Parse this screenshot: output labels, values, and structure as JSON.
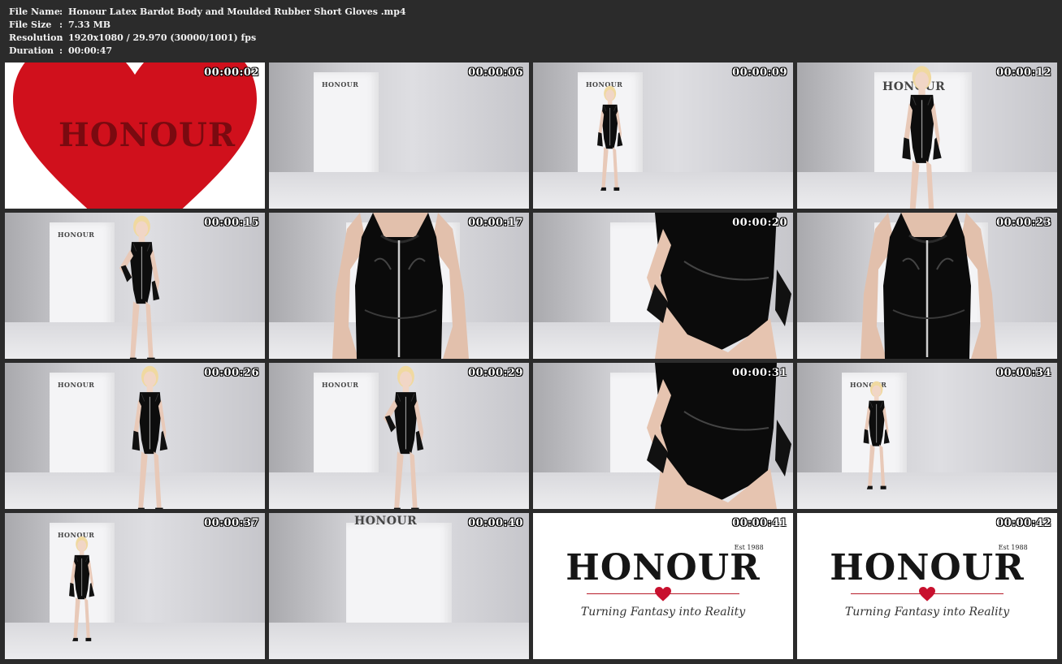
{
  "info": {
    "file_name_label": "File Name",
    "file_name": "Honour Latex Bardot Body and Moulded Rubber Short Gloves .mp4",
    "file_size_label": "File Size",
    "file_size": "7.33 MB",
    "resolution_label": "Resolution",
    "resolution": "1920x1080 / 29.970 (30000/1001) fps",
    "duration_label": "Duration",
    "duration": "00:00:47",
    "separator": ":"
  },
  "thumbs": [
    {
      "timestamp": "00:00:02",
      "kind": "heart",
      "sign": "HONOUR"
    },
    {
      "timestamp": "00:00:06",
      "kind": "empty",
      "sign": "HONOUR"
    },
    {
      "timestamp": "00:00:09",
      "kind": "figure-far",
      "sign": "HONOUR"
    },
    {
      "timestamp": "00:00:12",
      "kind": "figure-front",
      "sign": "HONOUR"
    },
    {
      "timestamp": "00:00:15",
      "kind": "figure-mid",
      "sign": "HONOUR"
    },
    {
      "timestamp": "00:00:17",
      "kind": "torso",
      "sign": ""
    },
    {
      "timestamp": "00:00:20",
      "kind": "back-close",
      "sign": ""
    },
    {
      "timestamp": "00:00:23",
      "kind": "torso-side",
      "sign": ""
    },
    {
      "timestamp": "00:00:26",
      "kind": "figure-side",
      "sign": "HONOUR"
    },
    {
      "timestamp": "00:00:29",
      "kind": "figure-mid",
      "sign": "HONOUR"
    },
    {
      "timestamp": "00:00:31",
      "kind": "back-close",
      "sign": ""
    },
    {
      "timestamp": "00:00:34",
      "kind": "figure-back",
      "sign": "HONOUR"
    },
    {
      "timestamp": "00:00:37",
      "kind": "figure-far",
      "sign": "HONOUR"
    },
    {
      "timestamp": "00:00:40",
      "kind": "empty-wide",
      "sign": "HONOUR"
    },
    {
      "timestamp": "00:00:41",
      "kind": "logo",
      "sign": "HONOUR"
    },
    {
      "timestamp": "00:00:42",
      "kind": "logo",
      "sign": "HONOUR"
    }
  ],
  "logo": {
    "word": "HONOUR",
    "est": "Est 1988",
    "tagline": "Turning Fantasy into Reality"
  },
  "colors": {
    "background": "#2b2b2b",
    "text": "#f2f2f2",
    "accent_red": "#c8102e"
  }
}
